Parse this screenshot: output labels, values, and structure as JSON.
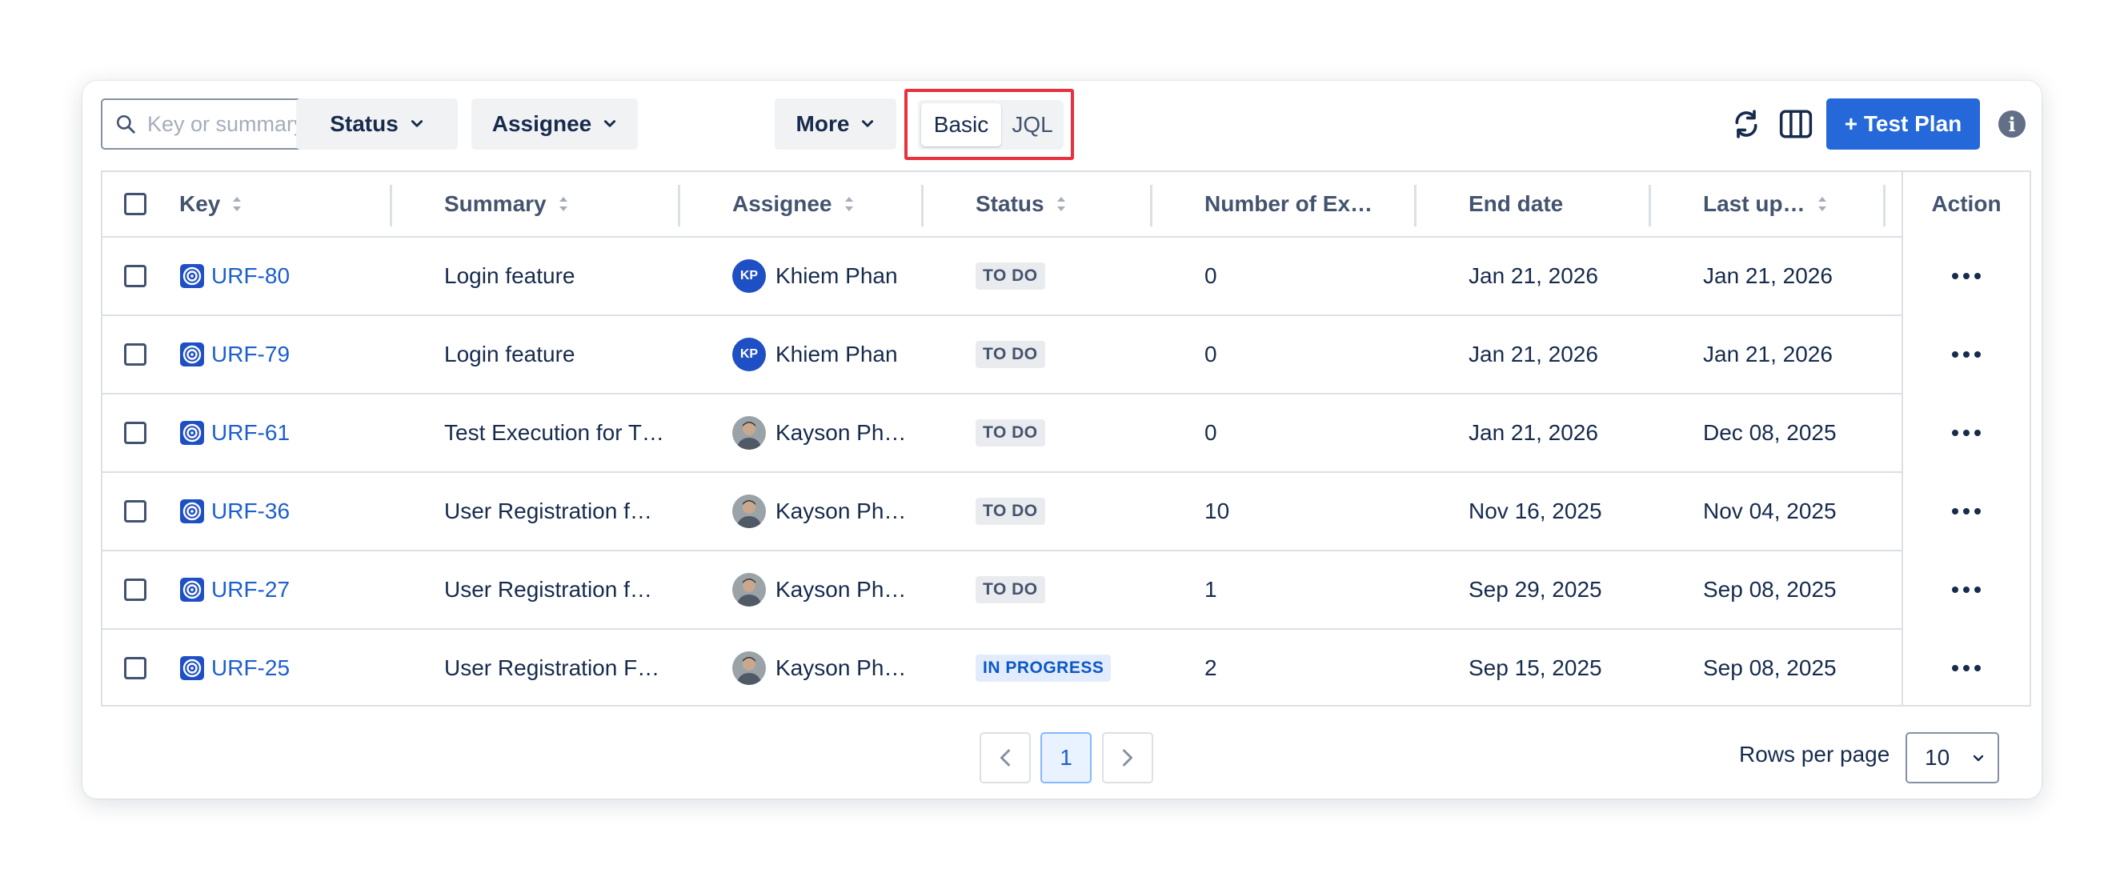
{
  "toolbar": {
    "search_placeholder": "Key or summary",
    "filters": [
      {
        "label": "Status"
      },
      {
        "label": "Assignee"
      },
      {
        "label": "More"
      }
    ],
    "mode_basic": "Basic",
    "mode_jql": "JQL",
    "add_label": "+ Test Plan",
    "info_label": "i"
  },
  "table": {
    "headers": {
      "key": "Key",
      "summary": "Summary",
      "assignee": "Assignee",
      "status": "Status",
      "executions": "Number of Ex…",
      "end_date": "End date",
      "last_updated": "Last up…",
      "action": "Action"
    },
    "rows": [
      {
        "key": "URF-80",
        "summary": "Login feature",
        "assignee": "Khiem Phan",
        "initials": "KP",
        "status": "TO DO",
        "executions": "0",
        "end_date": "Jan 21, 2026",
        "last_updated": "Jan 21, 2026"
      },
      {
        "key": "URF-79",
        "summary": "Login feature",
        "assignee": "Khiem Phan",
        "initials": "KP",
        "status": "TO DO",
        "executions": "0",
        "end_date": "Jan 21, 2026",
        "last_updated": "Jan 21, 2026"
      },
      {
        "key": "URF-61",
        "summary": "Test Execution for T…",
        "assignee": "Kayson Ph…",
        "initials": "",
        "status": "TO DO",
        "executions": "0",
        "end_date": "Jan 21, 2026",
        "last_updated": "Dec 08, 2025"
      },
      {
        "key": "URF-36",
        "summary": "User Registration f…",
        "assignee": "Kayson Ph…",
        "initials": "",
        "status": "TO DO",
        "executions": "10",
        "end_date": "Nov 16, 2025",
        "last_updated": "Nov 04, 2025"
      },
      {
        "key": "URF-27",
        "summary": "User Registration f…",
        "assignee": "Kayson Ph…",
        "initials": "",
        "status": "TO DO",
        "executions": "1",
        "end_date": "Sep 29, 2025",
        "last_updated": "Sep 08, 2025"
      },
      {
        "key": "URF-25",
        "summary": "User Registration F…",
        "assignee": "Kayson Ph…",
        "initials": "",
        "status": "IN PROGRESS",
        "executions": "2",
        "end_date": "Sep 15, 2025",
        "last_updated": "Sep 08, 2025"
      }
    ]
  },
  "pagination": {
    "current_page": "1",
    "rows_per_page_label": "Rows per page",
    "rows_per_page_value": "10"
  },
  "colors": {
    "primary": "#2468d9",
    "link": "#1d5fce",
    "highlight_border": "#e5323d"
  }
}
